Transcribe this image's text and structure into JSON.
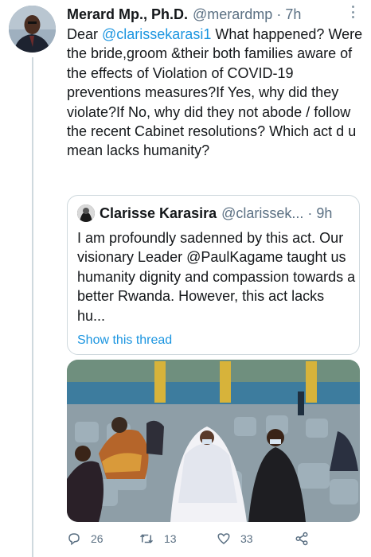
{
  "tweet": {
    "author_name": "Merard Mp., Ph.D.",
    "handle": "@merardmp",
    "separator": "·",
    "time": "7h",
    "text_lead": "Dear ",
    "mention": "@clarissekarasi1",
    "text_body": " What happened? Were the bride,groom &their both families aware of the effects of Violation of COVID-19 preventions measures?If Yes, why did they violate?If No, why did they not abode / follow the recent Cabinet resolutions? Which act d u mean lacks humanity?"
  },
  "quoted_tweet": {
    "author_name": "Clarisse Karasira",
    "handle": "@clarissek...",
    "separator": "·",
    "time": "9h",
    "text": "I am profoundly sadenned by this act. Our visionary Leader @PaulKagame taught us humanity dignity and compassion towards a better Rwanda. However, this act lacks hu...",
    "show_thread": "Show this thread"
  },
  "actions": {
    "reply_count": "26",
    "retweet_count": "13",
    "like_count": "33"
  },
  "colors": {
    "accent": "#1b95e0",
    "muted": "#5b7083",
    "border": "#cfd9de"
  },
  "icons": [
    "more-options-icon",
    "reply-icon",
    "retweet-icon",
    "like-icon",
    "share-icon"
  ]
}
